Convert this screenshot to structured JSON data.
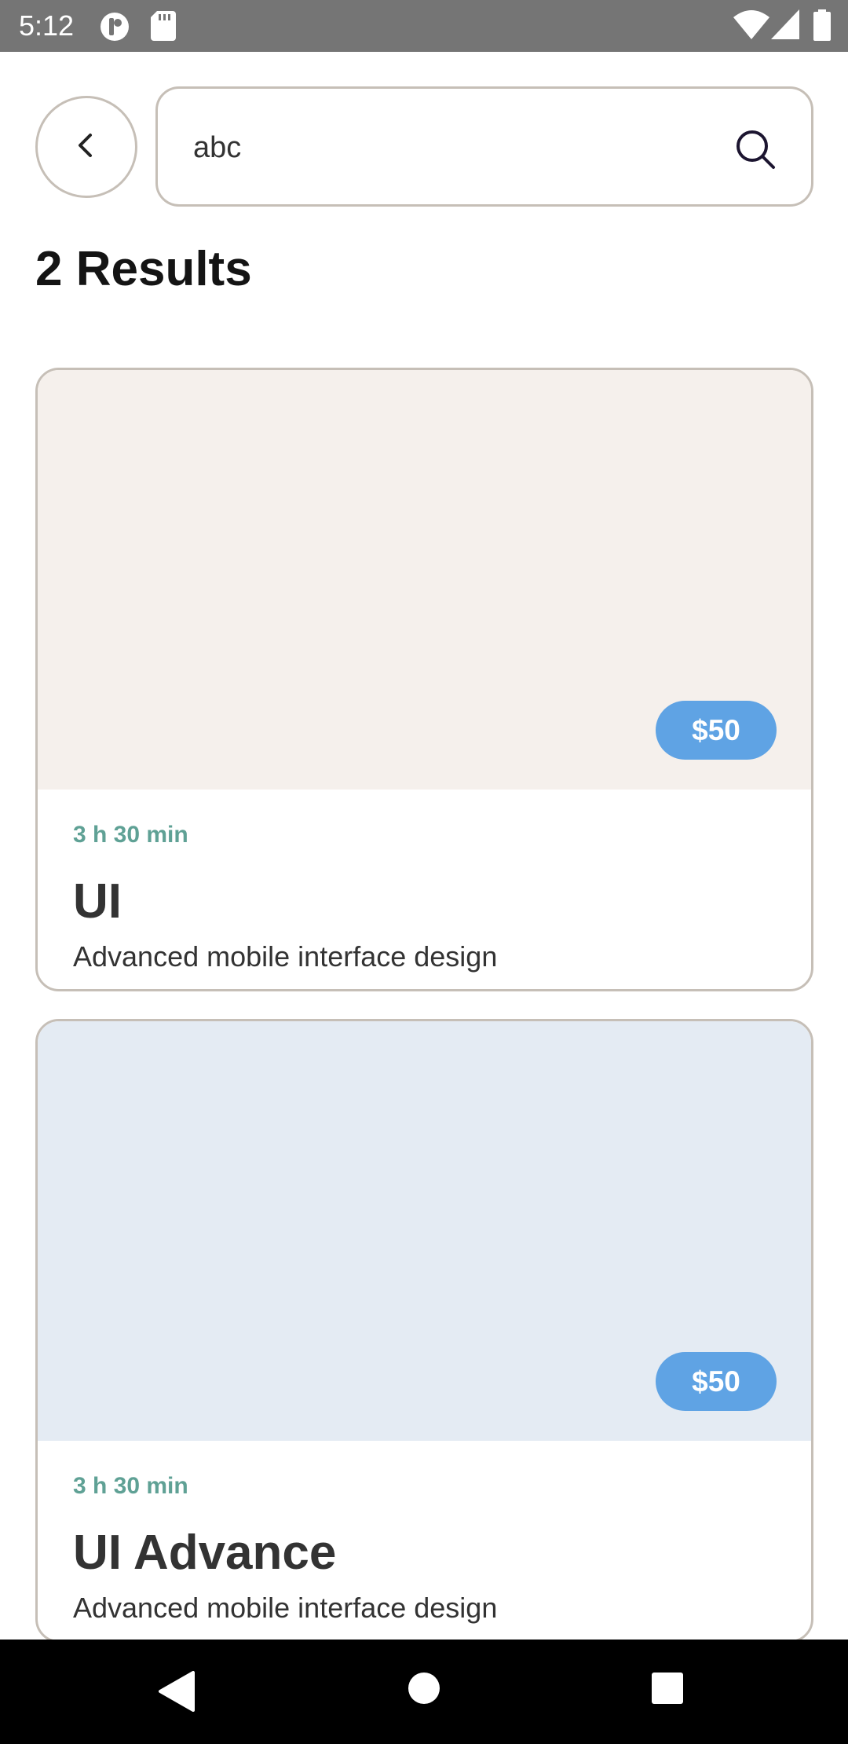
{
  "status_bar": {
    "time": "5:12"
  },
  "search": {
    "value": "abc",
    "placeholder": ""
  },
  "results": {
    "title": "2 Results",
    "items": [
      {
        "duration": "3 h 30 min",
        "title": "UI",
        "description": "Advanced mobile interface design",
        "price": "$50",
        "image_color": "#f5f0ec"
      },
      {
        "duration": "3 h 30 min",
        "title": "UI Advance",
        "description": "Advanced mobile interface design",
        "price": "$50",
        "image_color": "#e4ebf3"
      }
    ]
  },
  "colors": {
    "price_badge": "#5fa3e4",
    "duration_text": "#5fa195",
    "border": "#c6bfb7"
  },
  "icons": {
    "back": "chevron-left-icon",
    "search": "search-icon",
    "nav_back": "triangle-back-icon",
    "nav_home": "circle-home-icon",
    "nav_recents": "square-recents-icon"
  }
}
